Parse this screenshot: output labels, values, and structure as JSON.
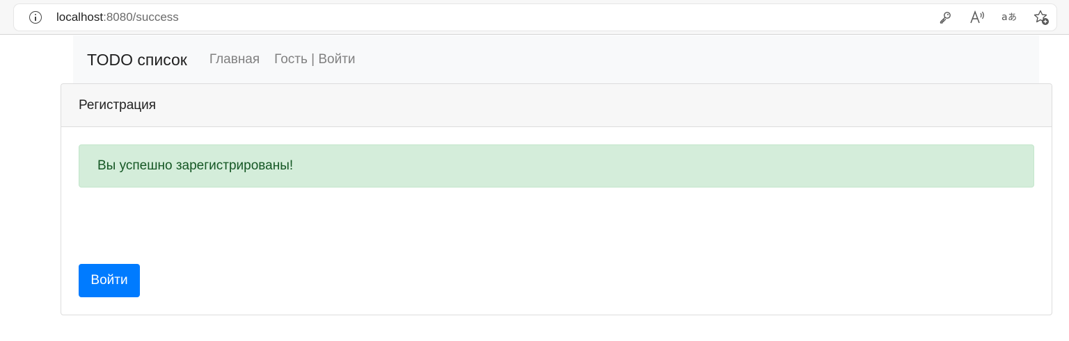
{
  "browser": {
    "url_host": "localhost",
    "url_rest": ":8080/success",
    "icons": [
      "info-icon",
      "key-icon",
      "read-aloud-icon",
      "translate-icon",
      "add-favorite-icon"
    ]
  },
  "navbar": {
    "brand": "TODO список",
    "home_link": "Главная",
    "user_link": "Гость | Войти"
  },
  "card": {
    "header": "Регистрация",
    "alert": "Вы успешно зарегистрированы!",
    "login_button": "Войти"
  },
  "colors": {
    "primary": "#007bff",
    "alert_bg": "#d4edda",
    "alert_text": "#155724"
  }
}
